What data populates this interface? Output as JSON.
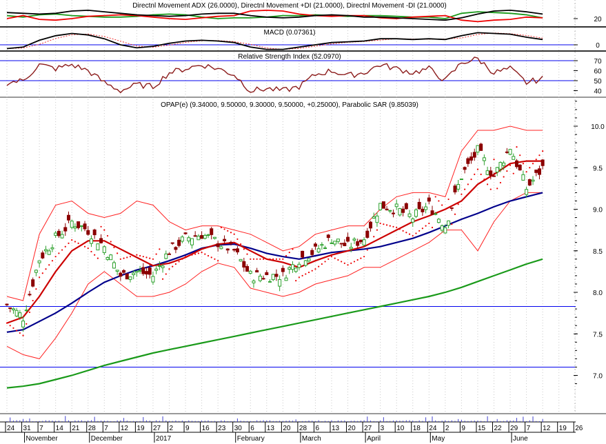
{
  "panels": {
    "dmi_title": "Directnl Movement ADX (26.0000), Directnl Movement +DI (21.0000), Directnl Movement -DI (21.0000)",
    "macd_title": "MACD (0.07361)",
    "rsi_title": "Relative Strength Index (52.0970)",
    "price_title": "OPAP(e) (9.34000, 9.50000, 9.30000, 9.50000, +0.25000), Parabolic SAR (9.85039)"
  },
  "axes": {
    "dmi_labels": [
      "20"
    ],
    "macd_labels": [
      "0"
    ],
    "rsi_labels": [
      "70",
      "60",
      "50",
      "40"
    ],
    "price_labels": [
      "10.0",
      "9.5",
      "9.0",
      "8.5",
      "8.0",
      "7.5",
      "7.0"
    ],
    "date_ticks": [
      "24",
      "31",
      "7",
      "14",
      "21",
      "28",
      "7",
      "12",
      "19",
      "27",
      "2",
      "9",
      "16",
      "23",
      "30",
      "6",
      "13",
      "20",
      "28",
      "6",
      "13",
      "20",
      "27",
      "3",
      "10",
      "18",
      "24",
      "2",
      "9",
      "15",
      "22",
      "29",
      "7",
      "12",
      "19",
      "26"
    ],
    "months": [
      {
        "label": "November",
        "tick": 1
      },
      {
        "label": "December",
        "tick": 5
      },
      {
        "label": "2017",
        "tick": 9
      },
      {
        "label": "February",
        "tick": 14
      },
      {
        "label": "March",
        "tick": 18
      },
      {
        "label": "April",
        "tick": 22
      },
      {
        "label": "May",
        "tick": 26
      },
      {
        "label": "June",
        "tick": 31
      }
    ]
  },
  "colors": {
    "up": "#2ca02c",
    "down": "#8b0000",
    "ma20": "#cc0000",
    "ma50": "#00008b",
    "ma200": "#1a9a1a",
    "bb": "#ff2020",
    "sar": "#ee0000",
    "hline": "#0000ee",
    "rsi": "#8b1a1a"
  },
  "chart_data": {
    "type": "line",
    "title": "OPAP(e)",
    "x": [
      "Oct 24",
      "Oct 31",
      "Nov 7",
      "Nov 14",
      "Nov 21",
      "Nov 28",
      "Dec 7",
      "Dec 12",
      "Dec 19",
      "Dec 27",
      "Jan 2",
      "Jan 9",
      "Jan 16",
      "Jan 23",
      "Jan 30",
      "Feb 6",
      "Feb 13",
      "Feb 20",
      "Feb 28",
      "Mar 6",
      "Mar 13",
      "Mar 20",
      "Mar 27",
      "Apr 3",
      "Apr 10",
      "Apr 18",
      "Apr 24",
      "May 2",
      "May 9",
      "May 15",
      "May 22",
      "May 29",
      "Jun 7",
      "Jun 12"
    ],
    "ylim": [
      6.8,
      10.3
    ],
    "horizontal_lines": [
      7.83,
      7.1
    ],
    "series": [
      {
        "name": "Close",
        "values": [
          7.85,
          7.7,
          8.4,
          8.65,
          8.85,
          8.75,
          8.55,
          8.2,
          8.25,
          8.2,
          8.5,
          8.65,
          8.7,
          8.6,
          8.5,
          8.2,
          8.2,
          8.2,
          8.4,
          8.5,
          8.65,
          8.55,
          8.65,
          9.05,
          9.0,
          8.9,
          9.05,
          8.8,
          9.4,
          9.7,
          9.4,
          9.75,
          9.25,
          9.5
        ]
      },
      {
        "name": "MA short",
        "values": [
          7.63,
          7.7,
          7.95,
          8.25,
          8.5,
          8.62,
          8.62,
          8.52,
          8.42,
          8.32,
          8.35,
          8.42,
          8.52,
          8.58,
          8.6,
          8.5,
          8.4,
          8.36,
          8.3,
          8.38,
          8.45,
          8.5,
          8.55,
          8.65,
          8.75,
          8.85,
          8.92,
          9.0,
          9.1,
          9.3,
          9.42,
          9.55,
          9.58,
          9.58
        ]
      },
      {
        "name": "MA medium",
        "values": [
          7.52,
          7.55,
          7.65,
          7.75,
          7.87,
          8.0,
          8.12,
          8.2,
          8.27,
          8.32,
          8.38,
          8.45,
          8.53,
          8.57,
          8.58,
          8.53,
          8.47,
          8.43,
          8.4,
          8.44,
          8.48,
          8.5,
          8.52,
          8.55,
          8.6,
          8.65,
          8.72,
          8.8,
          8.88,
          8.95,
          9.03,
          9.1,
          9.15,
          9.2
        ]
      },
      {
        "name": "MA long",
        "values": [
          6.85,
          6.87,
          6.9,
          6.95,
          7.0,
          7.06,
          7.12,
          7.17,
          7.22,
          7.27,
          7.31,
          7.35,
          7.39,
          7.43,
          7.47,
          7.51,
          7.55,
          7.59,
          7.63,
          7.67,
          7.71,
          7.75,
          7.79,
          7.83,
          7.87,
          7.91,
          7.95,
          8.0,
          8.06,
          8.13,
          8.2,
          8.27,
          8.34,
          8.4
        ]
      },
      {
        "name": "BB upper",
        "values": [
          7.95,
          7.9,
          8.7,
          9.05,
          9.1,
          8.95,
          8.9,
          8.95,
          9.1,
          9.05,
          8.85,
          8.75,
          8.8,
          8.8,
          8.75,
          8.7,
          8.6,
          8.5,
          8.55,
          8.7,
          8.75,
          8.8,
          8.8,
          9.0,
          9.15,
          9.2,
          9.2,
          9.15,
          9.7,
          9.95,
          9.95,
          10.0,
          9.95,
          9.95
        ]
      },
      {
        "name": "BB lower",
        "values": [
          7.35,
          7.25,
          7.2,
          7.45,
          7.75,
          8.1,
          8.25,
          8.1,
          7.95,
          7.95,
          8.0,
          8.1,
          8.25,
          8.35,
          8.3,
          8.05,
          8.0,
          7.95,
          8.0,
          8.1,
          8.15,
          8.2,
          8.3,
          8.3,
          8.4,
          8.5,
          8.6,
          8.75,
          8.75,
          8.5,
          8.85,
          9.1,
          9.2,
          9.2
        ]
      },
      {
        "name": "RSI",
        "values": [
          48,
          50,
          66,
          62,
          66,
          60,
          48,
          40,
          46,
          44,
          58,
          62,
          66,
          62,
          56,
          40,
          42,
          40,
          44,
          56,
          60,
          55,
          58,
          66,
          62,
          58,
          62,
          50,
          68,
          72,
          58,
          62,
          48,
          52
        ]
      },
      {
        "name": "MACD",
        "values": [
          -0.05,
          -0.03,
          0.06,
          0.12,
          0.15,
          0.13,
          0.08,
          0.0,
          -0.04,
          -0.02,
          0.02,
          0.05,
          0.06,
          0.05,
          0.03,
          -0.03,
          -0.06,
          -0.06,
          -0.03,
          0.0,
          0.03,
          0.04,
          0.05,
          0.08,
          0.08,
          0.07,
          0.08,
          0.07,
          0.12,
          0.16,
          0.15,
          0.14,
          0.1,
          0.07
        ]
      },
      {
        "name": "ADX",
        "values": [
          28,
          27,
          26,
          27,
          30,
          31,
          29,
          27,
          25,
          24,
          23,
          24,
          26,
          27,
          27,
          24,
          22,
          21,
          22,
          24,
          25,
          24,
          22,
          22,
          21,
          20,
          19,
          18,
          21,
          26,
          30,
          31,
          29,
          26
        ]
      },
      {
        "name": "+DI",
        "values": [
          24,
          22,
          25,
          26,
          24,
          23,
          22,
          22,
          23,
          25,
          26,
          25,
          22,
          20,
          21,
          21,
          22,
          24,
          24,
          25,
          24,
          23,
          24,
          24,
          23,
          22,
          22,
          20,
          27,
          29,
          28,
          27,
          25,
          21
        ]
      },
      {
        "name": "-DI",
        "values": [
          20,
          24,
          19,
          18,
          20,
          23,
          24,
          25,
          24,
          22,
          20,
          19,
          21,
          23,
          24,
          30,
          31,
          30,
          26,
          24,
          23,
          24,
          24,
          21,
          20,
          22,
          23,
          24,
          18,
          16,
          18,
          19,
          22,
          21
        ]
      }
    ]
  }
}
